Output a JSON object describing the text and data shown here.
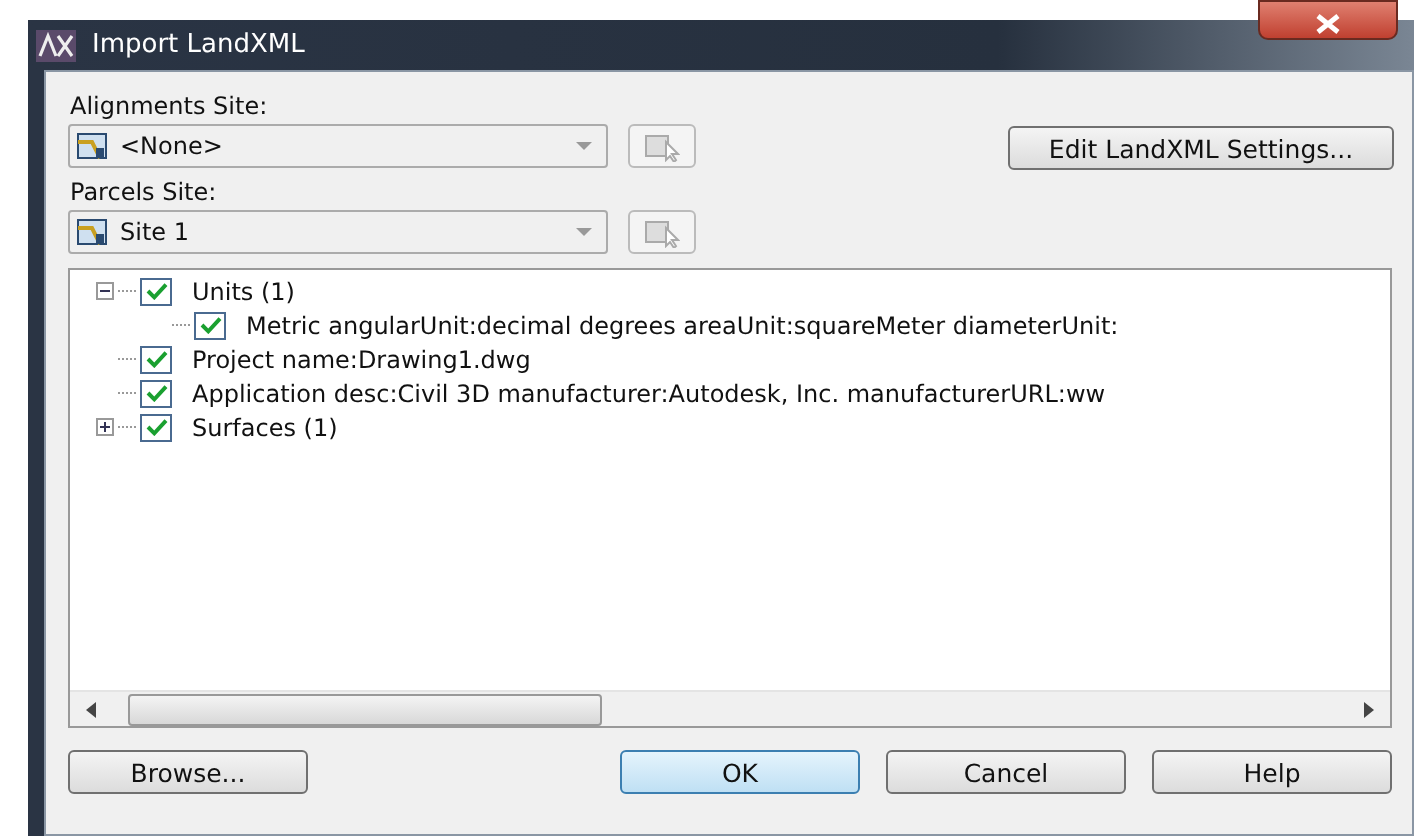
{
  "window": {
    "title": "Import LandXML"
  },
  "alignments_site": {
    "label": "Alignments Site:",
    "value": "<None>"
  },
  "parcels_site": {
    "label": "Parcels Site:",
    "value": "Site 1"
  },
  "edit_settings_button": "Edit LandXML Settings...",
  "tree": [
    {
      "label": "Units (1)",
      "checked": true,
      "expanded": true,
      "children": [
        {
          "label": "Metric angularUnit:decimal degrees areaUnit:squareMeter diameterUnit:",
          "checked": true
        }
      ]
    },
    {
      "label": "Project name:Drawing1.dwg",
      "checked": true
    },
    {
      "label": "Application desc:Civil 3D manufacturer:Autodesk, Inc. manufacturerURL:ww",
      "checked": true
    },
    {
      "label": "Surfaces (1)",
      "checked": true,
      "expanded": false
    }
  ],
  "buttons": [
    {
      "label": "Browse...",
      "kind": "left"
    },
    {
      "label": "OK",
      "kind": "default"
    },
    {
      "label": "Cancel",
      "kind": "normal"
    },
    {
      "label": "Help",
      "kind": "normal"
    }
  ]
}
